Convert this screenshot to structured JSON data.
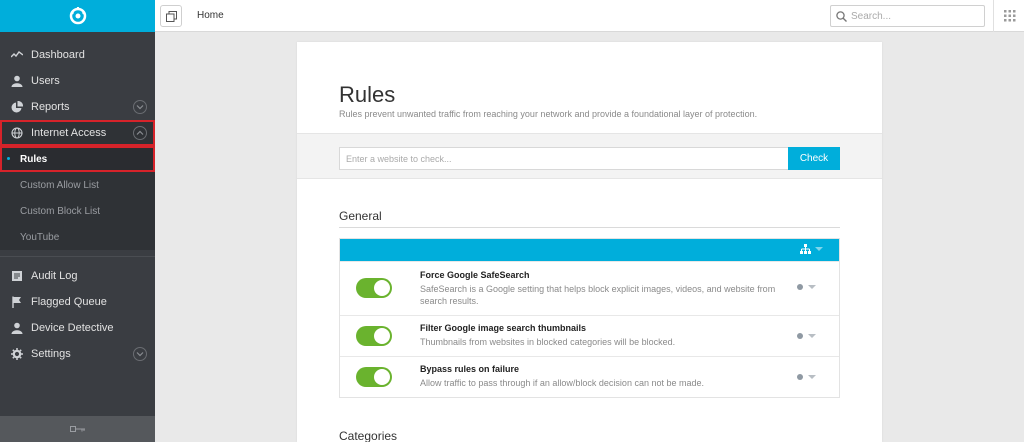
{
  "sidebar": {
    "items": [
      {
        "label": "Dashboard",
        "icon": "activity-icon"
      },
      {
        "label": "Users",
        "icon": "user-icon"
      },
      {
        "label": "Reports",
        "icon": "pie-chart-icon"
      },
      {
        "label": "Internet Access",
        "icon": "globe-icon"
      }
    ],
    "sub_items": [
      {
        "label": "Rules"
      },
      {
        "label": "Custom Allow List"
      },
      {
        "label": "Custom Block List"
      },
      {
        "label": "YouTube"
      }
    ],
    "items2": [
      {
        "label": "Audit Log",
        "icon": "log-icon"
      },
      {
        "label": "Flagged Queue",
        "icon": "flag-icon"
      },
      {
        "label": "Device Detective",
        "icon": "user-icon"
      },
      {
        "label": "Settings",
        "icon": "gear-icon"
      }
    ]
  },
  "topbar": {
    "breadcrumb": "Home",
    "search_placeholder": "Search..."
  },
  "page": {
    "title": "Rules",
    "subtitle": "Rules prevent unwanted traffic from reaching your network and provide a foundational layer of protection.",
    "check_placeholder": "Enter a website to check...",
    "check_button": "Check"
  },
  "sections": {
    "general": "General",
    "categories": "Categories"
  },
  "rules": [
    {
      "name": "Force Google SafeSearch",
      "desc": "SafeSearch is a Google setting that helps block explicit images, videos, and website from search results.",
      "enabled": true
    },
    {
      "name": "Filter Google image search thumbnails",
      "desc": "Thumbnails from websites in blocked categories will be blocked.",
      "enabled": true
    },
    {
      "name": "Bypass rules on failure",
      "desc": "Allow traffic to pass through if an allow/block decision can not be made.",
      "enabled": true
    }
  ],
  "colors": {
    "accent": "#00aedb",
    "toggle_on": "#6ab32e",
    "highlight": "#d6232a",
    "sidebar_bg": "#3a3d42"
  }
}
